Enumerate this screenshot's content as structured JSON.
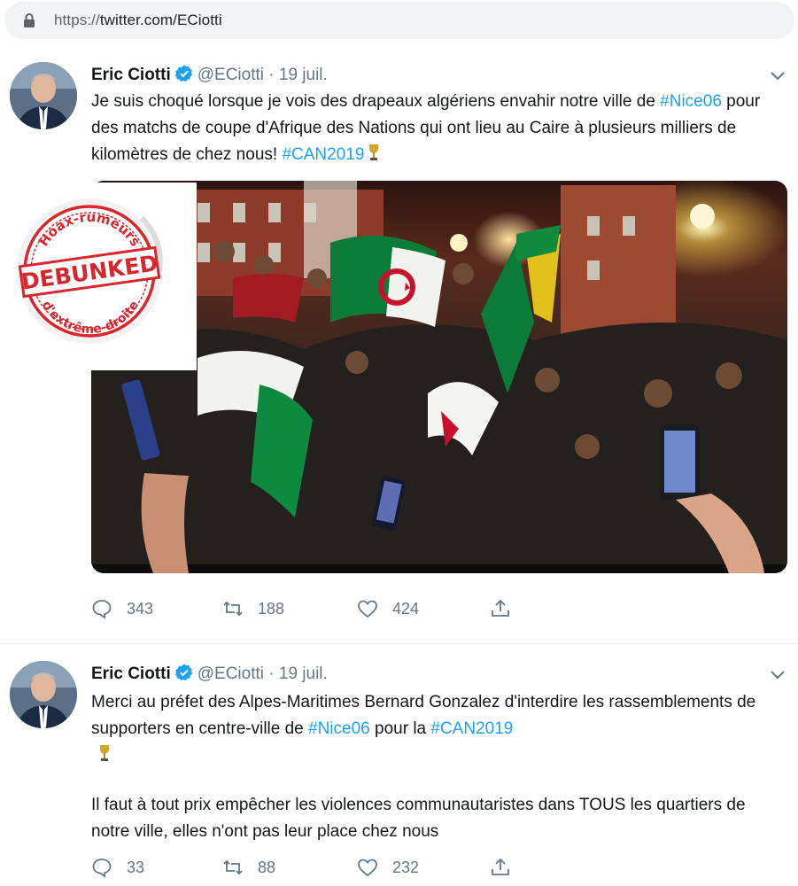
{
  "browser": {
    "url_scheme": "https://",
    "url_rest": "twitter.com/ECiotti"
  },
  "sticker": {
    "top_text": "Hoax-rumeurs",
    "center_text": "DEBUNKED",
    "bottom_text": "d'extrême-droite"
  },
  "tweets": [
    {
      "name": "Eric Ciotti",
      "handle": "@ECiotti",
      "sep": "·",
      "date": "19 juil.",
      "text_parts": {
        "p1": "Je suis choqué lorsque je vois des drapeaux algériens envahir notre ville de ",
        "tag1": "#Nice06",
        "p2": " pour des matchs de coupe d'Afrique des Nations qui ont lieu au Caire à plusieurs milliers de kilomètres de chez nous! ",
        "tag2": "#CAN2019"
      },
      "replies": "343",
      "retweets": "188",
      "likes": "424"
    },
    {
      "name": "Eric Ciotti",
      "handle": "@ECiotti",
      "sep": "·",
      "date": "19 juil.",
      "text_parts": {
        "p1": "Merci au préfet des Alpes-Maritimes Bernard Gonzalez d'interdire les rassemblements de supporters en centre-ville de ",
        "tag1": "#Nice06",
        "p2": " pour la ",
        "tag2": "#CAN2019",
        "p3": "Il faut à tout prix empêcher les violences communautaristes dans TOUS les quartiers de notre ville, elles n'ont pas leur place chez nous"
      },
      "replies": "33",
      "retweets": "88",
      "likes": "232"
    }
  ],
  "colors": {
    "accent": "#1da1f2",
    "secondary_text": "#657786",
    "primary_text": "#14171a",
    "debunk_red": "#d7262e"
  },
  "icons": [
    "lock-icon",
    "verified-badge-icon",
    "chevron-down-icon",
    "trophy-icon",
    "reply-icon",
    "retweet-icon",
    "like-icon",
    "share-icon"
  ]
}
